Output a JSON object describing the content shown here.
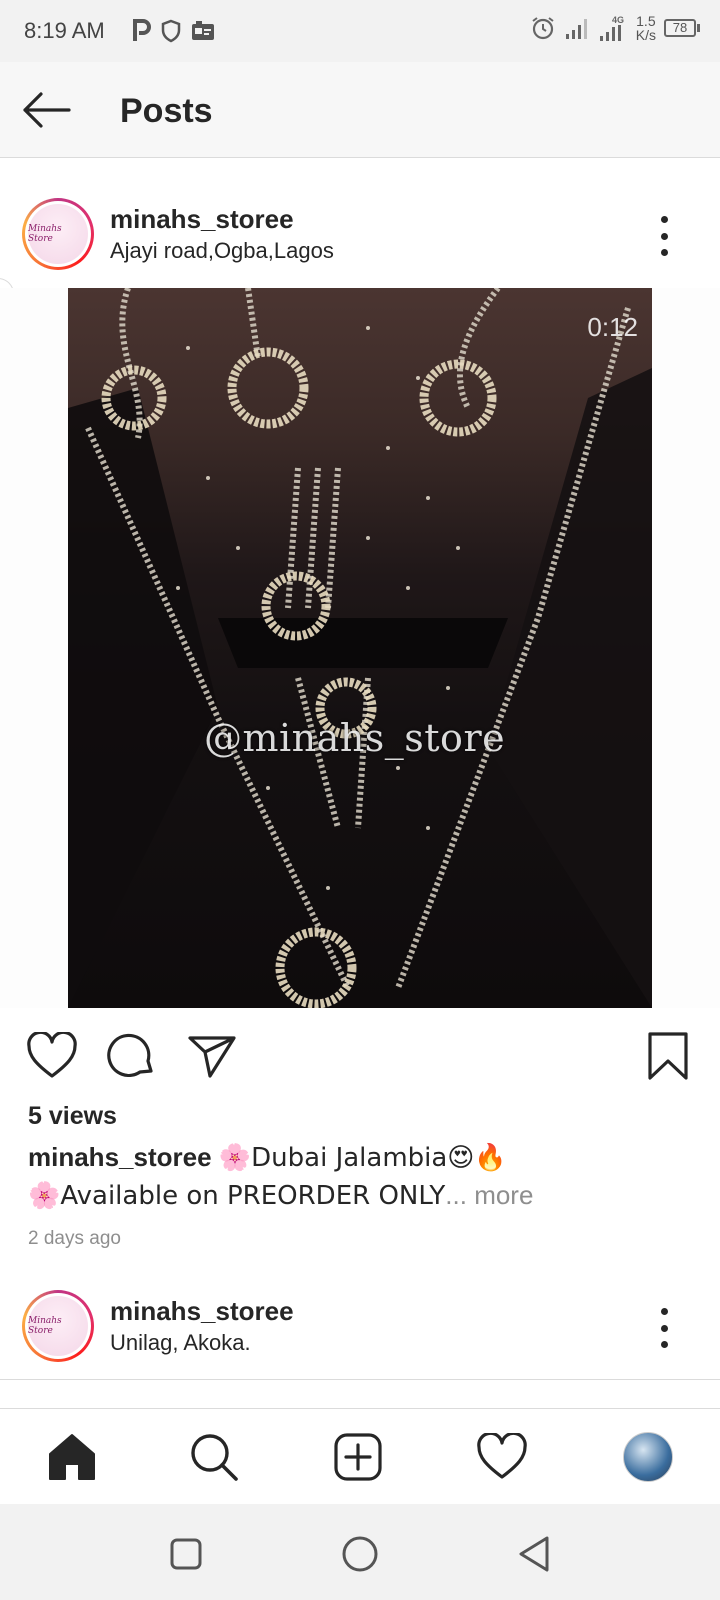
{
  "status_bar": {
    "time": "8:19 AM",
    "network_speed_value": "1.5",
    "network_speed_unit": "K/s",
    "network_type": "4G",
    "battery": "78",
    "icons": [
      "p-icon",
      "shield-icon",
      "card-icon",
      "alarm-icon",
      "signal-icon",
      "signal-icon-2",
      "battery-icon"
    ]
  },
  "header": {
    "title": "Posts"
  },
  "post": {
    "username": "minahs_storee",
    "location": "Ajayi road,Ogba,Lagos",
    "avatar_text": "Minahs Store",
    "video_time": "0:12",
    "watermark": "@minahs_store",
    "views": "5 views",
    "caption_user": "minahs_storee",
    "caption_line1": "🌸Dubai Jalambia😍🔥",
    "caption_line2": "🌸Available on PREORDER ONLY",
    "more": "... more",
    "timestamp": "2 days ago"
  },
  "next_post": {
    "username": "minahs_storee",
    "location": "Unilag, Akoka.",
    "avatar_text": "Minahs Store"
  },
  "bottom_nav": [
    "home-icon",
    "search-icon",
    "add-post-icon",
    "activity-heart-icon",
    "profile-avatar"
  ],
  "system_nav": [
    "recents-square",
    "home-circle",
    "back-triangle"
  ],
  "colors": {
    "accent": "#262626",
    "secondary_text": "#8e8e8e",
    "ring_start": "#c13584",
    "ring_end": "#fcaf45"
  }
}
